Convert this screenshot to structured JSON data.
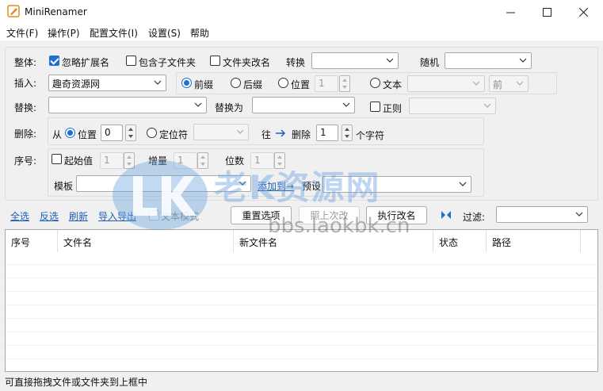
{
  "window": {
    "title": "MiniRenamer"
  },
  "menu": [
    "文件(F)",
    "操作(P)",
    "配置文件(I)",
    "设置(S)",
    "帮助"
  ],
  "overall": {
    "label": "整体:",
    "ignore_ext": "忽略扩展名",
    "include_subdir": "包含子文件夹",
    "folder_rename": "文件夹改名",
    "convert_label": "转换",
    "random_label": "随机"
  },
  "insert": {
    "label": "插入:",
    "value": "趣奇资源网",
    "prefix": "前缀",
    "suffix": "后缀",
    "position": "位置",
    "position_value": "1",
    "text": "文本",
    "front": "前"
  },
  "replace": {
    "label": "替换:",
    "replace_with": "替换为",
    "regex": "正则"
  },
  "delete": {
    "label": "删除:",
    "from": "从",
    "position": "位置",
    "position_value": "0",
    "locator": "定位符",
    "to": "往",
    "delete_word": "删除",
    "count": "1",
    "unit": "个字符"
  },
  "sequence": {
    "label": "序号:",
    "start_label": "起始值",
    "start_value": "1",
    "increment_label": "增量",
    "increment_value": "1",
    "digits_label": "位数",
    "digits_value": "1",
    "template_label": "模板",
    "add_to": "添加到→",
    "preset": "预设"
  },
  "toolbar": {
    "select_all": "全选",
    "invert": "反选",
    "refresh": "刷新",
    "import_export": "导入导出",
    "text_mode": "文本模式",
    "reset": "重置选项",
    "last_time": "照上次改",
    "execute": "执行改名",
    "filter": "过滤:"
  },
  "table": {
    "columns": [
      "序号",
      "文件名",
      "新文件名",
      "状态",
      "路径"
    ]
  },
  "statusbar": "可直接拖拽文件或文件夹到上框中",
  "watermark": {
    "title": "老K资源网",
    "url": "bbs.laokbk.cn"
  },
  "colors": {
    "accent": "#1e6fd0",
    "link": "#1e5fb8"
  }
}
